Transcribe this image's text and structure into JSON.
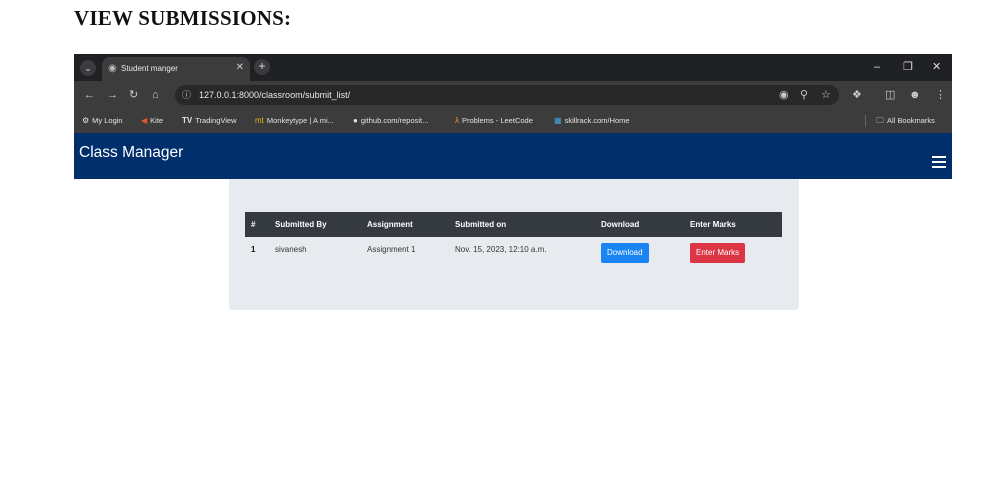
{
  "heading": "VIEW SUBMISSIONS:",
  "browser": {
    "tab_title": "Student manger",
    "url": "127.0.0.1:8000/classroom/submit_list/",
    "bookmarks": [
      {
        "label": "My Login",
        "icon": "⚙"
      },
      {
        "label": "Kite",
        "icon": "◀"
      },
      {
        "label": "TradingView",
        "icon": "TV"
      },
      {
        "label": "Monkeytype | A mi...",
        "icon": "mt"
      },
      {
        "label": "github.com/reposit...",
        "icon": "●"
      },
      {
        "label": "Problems - LeetCode",
        "icon": "λ"
      },
      {
        "label": "skillrack.com/Home",
        "icon": "▦"
      }
    ],
    "all_bookmarks": "All Bookmarks"
  },
  "app": {
    "brand": "Class Manager",
    "colors": {
      "navbar": "#002f6c",
      "table_header": "#343a40",
      "download": "#1a84f3",
      "enter_marks": "#dc3545"
    }
  },
  "table": {
    "headers": [
      "#",
      "Submitted By",
      "Assignment",
      "Submitted on",
      "Download",
      "Enter Marks"
    ],
    "rows": [
      {
        "num": "1",
        "submitted_by": "sivanesh",
        "assignment": "Assignment 1",
        "submitted_on": "Nov. 15, 2023, 12:10 a.m.",
        "download": "Download",
        "enter_marks": "Enter Marks"
      }
    ]
  }
}
